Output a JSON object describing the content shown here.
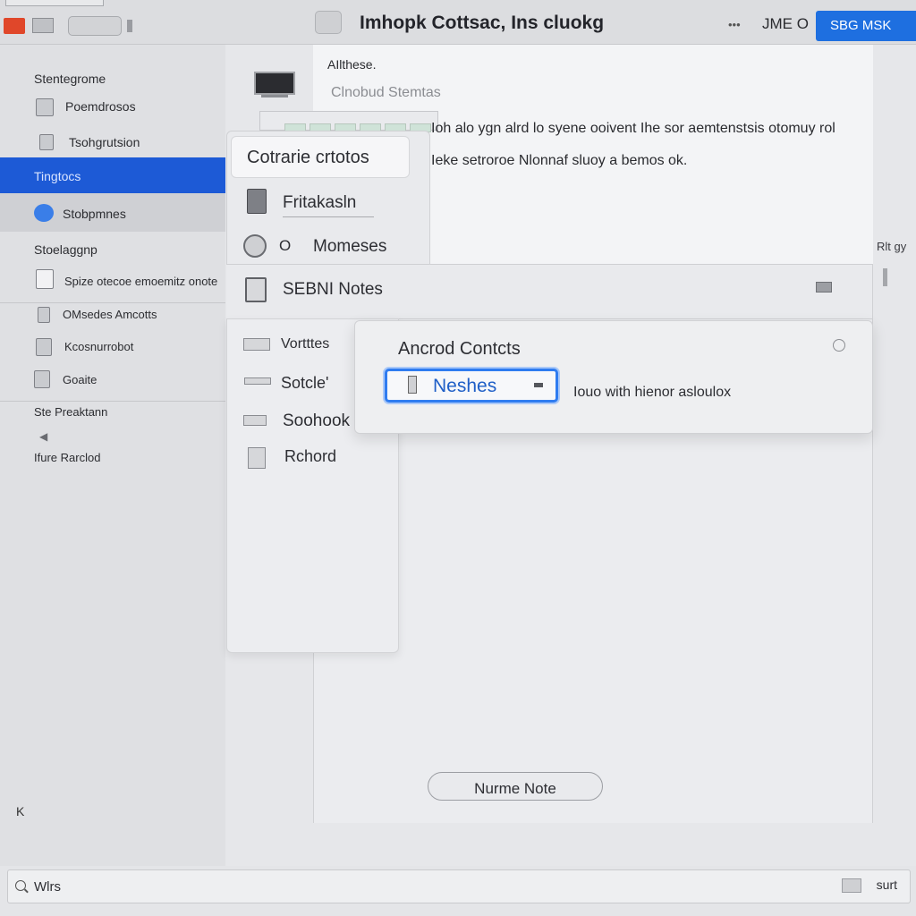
{
  "window": {
    "title": "Imhopk Cottsac, Ins cluokg",
    "menu_dots": "•••",
    "user": "JME O",
    "action_button": "SBG   MSK"
  },
  "sidebar": {
    "section1": "Stentegrome",
    "items1": [
      "Poemdrosos",
      "Tsohgrutsion"
    ],
    "active_item": "Tingtocs",
    "hover_item": "Stobpmnes",
    "section2": "Stoelaggnp",
    "items2": [
      "Spize otecoe emoemitz onote",
      "OMsedes Amcotts",
      "Kcosnurrobot",
      "Goaite"
    ],
    "section3": "Ste Preaktann",
    "back_arrow": "◀",
    "footer_item": "Ifure Rarclod",
    "close": "K"
  },
  "main": {
    "header_title": "AIlthese.",
    "header_subtitle": "Clnobud Stemtas",
    "line1": "Ioh alo ygn alrd lo syene ooivent Ihe sor aemtenstsis otomuy rol",
    "line2": "Ieke setroroe Nlonnaf sluoy a bemos ok.",
    "right_edge_label": "Rlt gy"
  },
  "dropdown": {
    "title": "Cotrarie crtotos",
    "items": [
      "Fritakasln",
      "Momeses"
    ],
    "item2_prefix": "O",
    "selected_row": "SEBNI Notes",
    "list": [
      "Vortttes",
      "Sotcle'",
      "Soohook",
      "Rchord"
    ]
  },
  "popup": {
    "title": "Ancrod Contcts",
    "field_value": "Neshes",
    "hint": "Iouo with hienor asloulox"
  },
  "new_note_button": "Nurme Note",
  "search": {
    "value": "Wlrs",
    "submit": "surt"
  }
}
